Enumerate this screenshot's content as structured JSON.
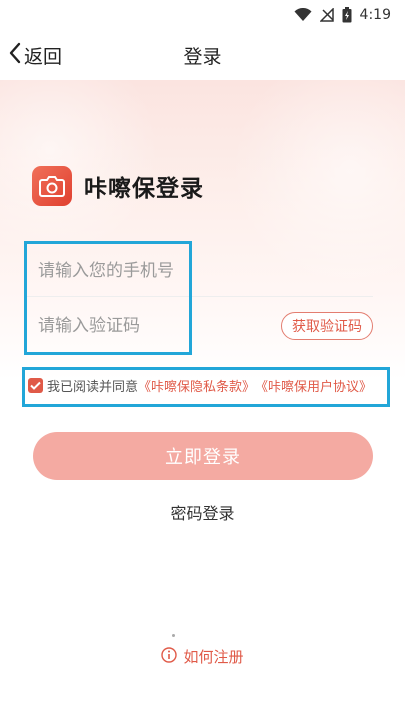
{
  "status_bar": {
    "time": "4:19"
  },
  "nav": {
    "back_label": "返回",
    "title": "登录"
  },
  "brand": {
    "title": "咔嚓保登录",
    "icon": "camera-icon"
  },
  "form": {
    "phone_placeholder": "请输入您的手机号",
    "code_placeholder": "请输入验证码",
    "get_code_label": "获取验证码"
  },
  "agreement": {
    "prefix": "我已阅读并同意",
    "privacy_link": "《咔嚓保隐私条款》",
    "user_link": "《咔嚓保用户协议》",
    "checked": true
  },
  "actions": {
    "login_label": "立即登录",
    "password_login_label": "密码登录",
    "how_register_label": "如何注册"
  },
  "colors": {
    "accent": "#e05a48",
    "login_button": "#f4aaa2",
    "highlight": "#22a6d8"
  }
}
